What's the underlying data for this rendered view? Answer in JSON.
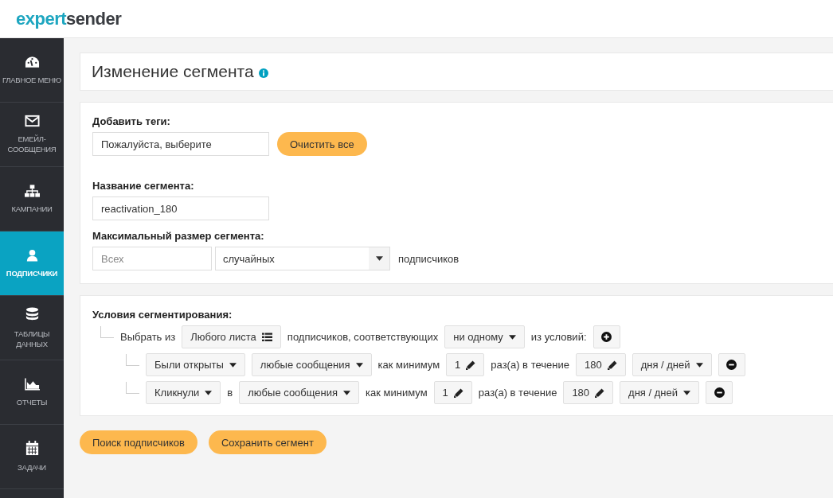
{
  "logo": {
    "part_1": "expert",
    "part_2": "sender"
  },
  "sidebar": {
    "items": [
      {
        "kind": "gauge",
        "label": "ГЛАВНОЕ МЕНЮ",
        "selected": false
      },
      {
        "kind": "envelope",
        "label": "ЕМЕЙЛ-СООБЩЕНИЯ",
        "selected": false
      },
      {
        "kind": "sitemap",
        "label": "КАМПАНИИ",
        "selected": false
      },
      {
        "kind": "user",
        "label": "ПОДПИСЧИКИ",
        "selected": true
      },
      {
        "kind": "database",
        "label": "ТАБЛИЦЫ ДАННЫХ",
        "selected": false
      },
      {
        "kind": "chart",
        "label": "ОТЧЕТЫ",
        "selected": false
      },
      {
        "kind": "calendar",
        "label": "ЗАДАЧИ",
        "selected": false
      }
    ]
  },
  "page_title": "Изменение сегмента",
  "form": {
    "tags": {
      "label": "Добавить теги:",
      "value": "Пожалуйста, выберите",
      "clear_button": "Очистить все"
    },
    "name": {
      "label": "Название сегмента:",
      "value": "reactivation_180"
    },
    "max_size": {
      "label": "Максимальный размер сегмента:",
      "placeholder": "Всех",
      "mode": "случайных",
      "suffix": "подписчиков"
    }
  },
  "conditions": {
    "label": "Условия сегментирования:",
    "root": [
      {
        "kind": "text",
        "text": "Выбрать из"
      },
      {
        "kind": "list-select",
        "text": "Любого листа"
      },
      {
        "kind": "text",
        "text": "подписчиков, соответствующих"
      },
      {
        "kind": "select",
        "text": "ни одному"
      },
      {
        "kind": "text",
        "text": "из условий:"
      },
      {
        "kind": "add"
      }
    ],
    "rows": [
      {
        "parts": [
          {
            "kind": "select",
            "text": "Были открыты"
          },
          {
            "kind": "select",
            "text": "любые сообщения"
          },
          {
            "kind": "text",
            "text": "как минимум"
          },
          {
            "kind": "edit",
            "text": "1"
          },
          {
            "kind": "text",
            "text": "раз(а) в течение"
          },
          {
            "kind": "edit",
            "text": "180"
          },
          {
            "kind": "select",
            "text": "дня / дней"
          },
          {
            "kind": "remove"
          }
        ]
      },
      {
        "parts": [
          {
            "kind": "select",
            "text": "Кликнули"
          },
          {
            "kind": "text",
            "text": "в"
          },
          {
            "kind": "select",
            "text": "любые сообщения"
          },
          {
            "kind": "text",
            "text": "как минимум"
          },
          {
            "kind": "edit",
            "text": "1"
          },
          {
            "kind": "text",
            "text": "раз(а) в течение"
          },
          {
            "kind": "edit",
            "text": "180"
          },
          {
            "kind": "select",
            "text": "дня / дней"
          },
          {
            "kind": "remove"
          }
        ]
      }
    ]
  },
  "actions": [
    "Поиск подписчиков",
    "Сохранить сегмент"
  ]
}
